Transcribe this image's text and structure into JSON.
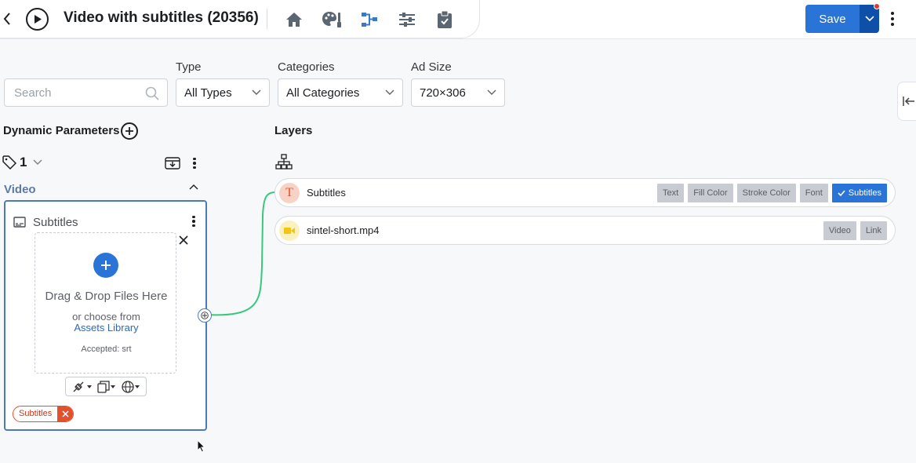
{
  "header": {
    "title": "Video with subtitles (20356)",
    "back_icon": "chevron-left-icon",
    "play_icon": "play-circle-icon",
    "nav_icons": [
      "home-icon",
      "palette-brush-icon",
      "flow-icon",
      "sliders-icon",
      "clipboard-icon"
    ],
    "save_label": "Save",
    "accent": "#2a74d8"
  },
  "filters": {
    "search_placeholder": "Search",
    "type_label": "Type",
    "type_value": "All Types",
    "categories_label": "Categories",
    "categories_value": "All Categories",
    "adsize_label": "Ad Size",
    "adsize_value": "720×306"
  },
  "dynamic_params": {
    "title": "Dynamic Parameters",
    "tag_count": "1",
    "group_title": "Video",
    "card": {
      "title": "Subtitles",
      "dropzone_main": "Drag & Drop Files Here",
      "dropzone_or": "or choose from",
      "dropzone_link": "Assets Library",
      "accepted": "Accepted: srt",
      "chip": "Subtitles"
    }
  },
  "layers": {
    "title": "Layers",
    "items": [
      {
        "name": "Subtitles",
        "icon": "text-icon",
        "tags": [
          "Text",
          "Fill Color",
          "Stroke Color",
          "Font"
        ],
        "active_tag": "Subtitles"
      },
      {
        "name": "sintel-short.mp4",
        "icon": "video-camera-icon",
        "tags": [
          "Video",
          "Link"
        ]
      }
    ]
  }
}
